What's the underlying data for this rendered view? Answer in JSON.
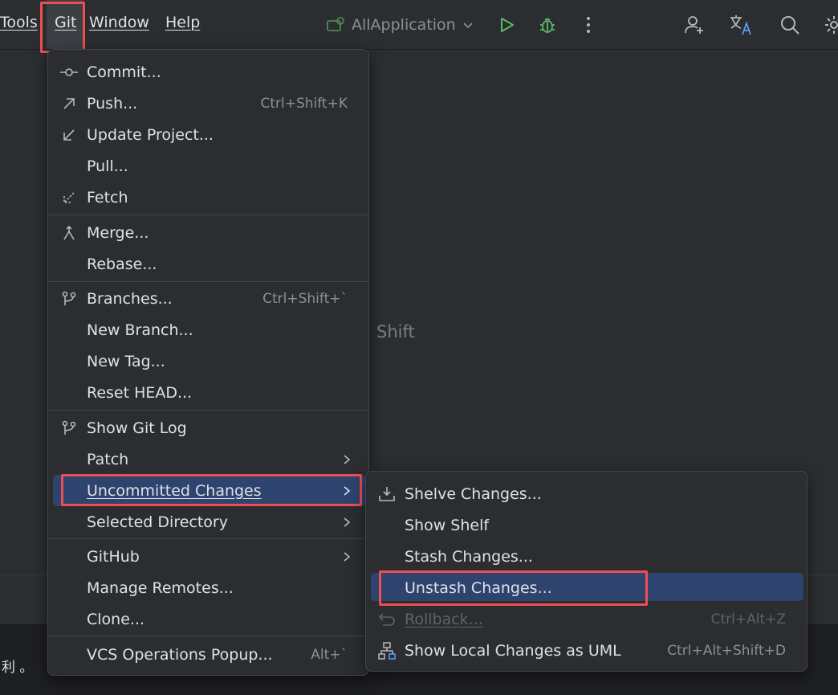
{
  "menubar": {
    "items": [
      {
        "label": "Tools"
      },
      {
        "label": "Git"
      },
      {
        "label": "Window"
      },
      {
        "label": "Help"
      }
    ],
    "run_config": "AllApplication"
  },
  "editor": {
    "hint_text": "Shift"
  },
  "status": {
    "bottom_text": "利 。"
  },
  "git_menu": {
    "commit": "Commit...",
    "push": "Push...",
    "push_sc": "Ctrl+Shift+K",
    "update": "Update Project...",
    "pull": "Pull...",
    "fetch": "Fetch",
    "merge": "Merge...",
    "rebase": "Rebase...",
    "branches": "Branches...",
    "branches_sc": "Ctrl+Shift+`",
    "new_branch": "New Branch...",
    "new_tag": "New Tag...",
    "reset_head": "Reset HEAD...",
    "show_log": "Show Git Log",
    "patch": "Patch",
    "uncommitted": "Uncommitted Changes",
    "selected_dir": "Selected Directory",
    "github": "GitHub",
    "manage_remotes": "Manage Remotes...",
    "clone": "Clone...",
    "vcs_popup": "VCS Operations Popup...",
    "vcs_popup_sc": "Alt+`"
  },
  "submenu": {
    "shelve": "Shelve Changes...",
    "show_shelf": "Show Shelf",
    "stash": "Stash Changes...",
    "unstash": "Unstash Changes...",
    "rollback": "Rollback...",
    "rollback_sc": "Ctrl+Alt+Z",
    "show_uml": "Show Local Changes as UML",
    "show_uml_sc": "Ctrl+Alt+Shift+D"
  },
  "colors": {
    "highlight": "#2e436e",
    "annotation_red": "#ef4d52",
    "run_green": "#5fb865"
  }
}
